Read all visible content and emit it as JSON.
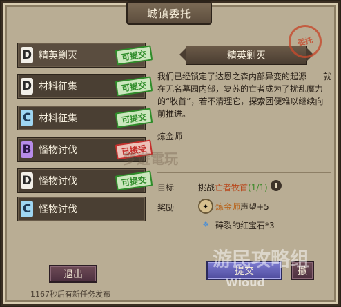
{
  "window": {
    "title": "城镇委托"
  },
  "quests": [
    {
      "rank": "D",
      "name": "精英剿灭",
      "status": "可提交",
      "status_type": "green",
      "active": true
    },
    {
      "rank": "D",
      "name": "材料征集",
      "status": "可提交",
      "status_type": "green",
      "active": false
    },
    {
      "rank": "C",
      "name": "材料征集",
      "status": "可提交",
      "status_type": "green",
      "active": false
    },
    {
      "rank": "B",
      "name": "怪物讨伐",
      "status": "已接受",
      "status_type": "red",
      "active": false
    },
    {
      "rank": "D",
      "name": "怪物讨伐",
      "status": "可提交",
      "status_type": "green",
      "active": false
    },
    {
      "rank": "C",
      "name": "怪物讨伐",
      "status": "",
      "status_type": "",
      "active": false
    }
  ],
  "detail": {
    "title": "精英剿灭",
    "seal_text": "委托",
    "description": "我们已经锁定了达恩之森内部异变的起源——就在无名墓园内部，复苏的亡者成为了扰乱魔力的“牧首”，若不清理它，探索团便难以继续向前推进。",
    "profession": "炼金师",
    "target_label": "目标",
    "target_prefix": "挑战",
    "target_name": "亡者牧首",
    "target_count": "(1/1)",
    "reward_label": "奖励",
    "reward_items": [
      {
        "icon": "reputation-medal-icon",
        "name": "炼金师",
        "suffix": "声望+5"
      },
      {
        "icon": "crystal-icon",
        "name": "碎裂的红宝石*3",
        "suffix": ""
      }
    ]
  },
  "buttons": {
    "exit_label": "退出",
    "submit_label": "提交",
    "abandon_label": "撤"
  },
  "countdown_text": "1167秒后有新任务发布",
  "watermarks": [
    "游民攻略组",
    "Wioud",
    "梦遊電玩"
  ]
}
